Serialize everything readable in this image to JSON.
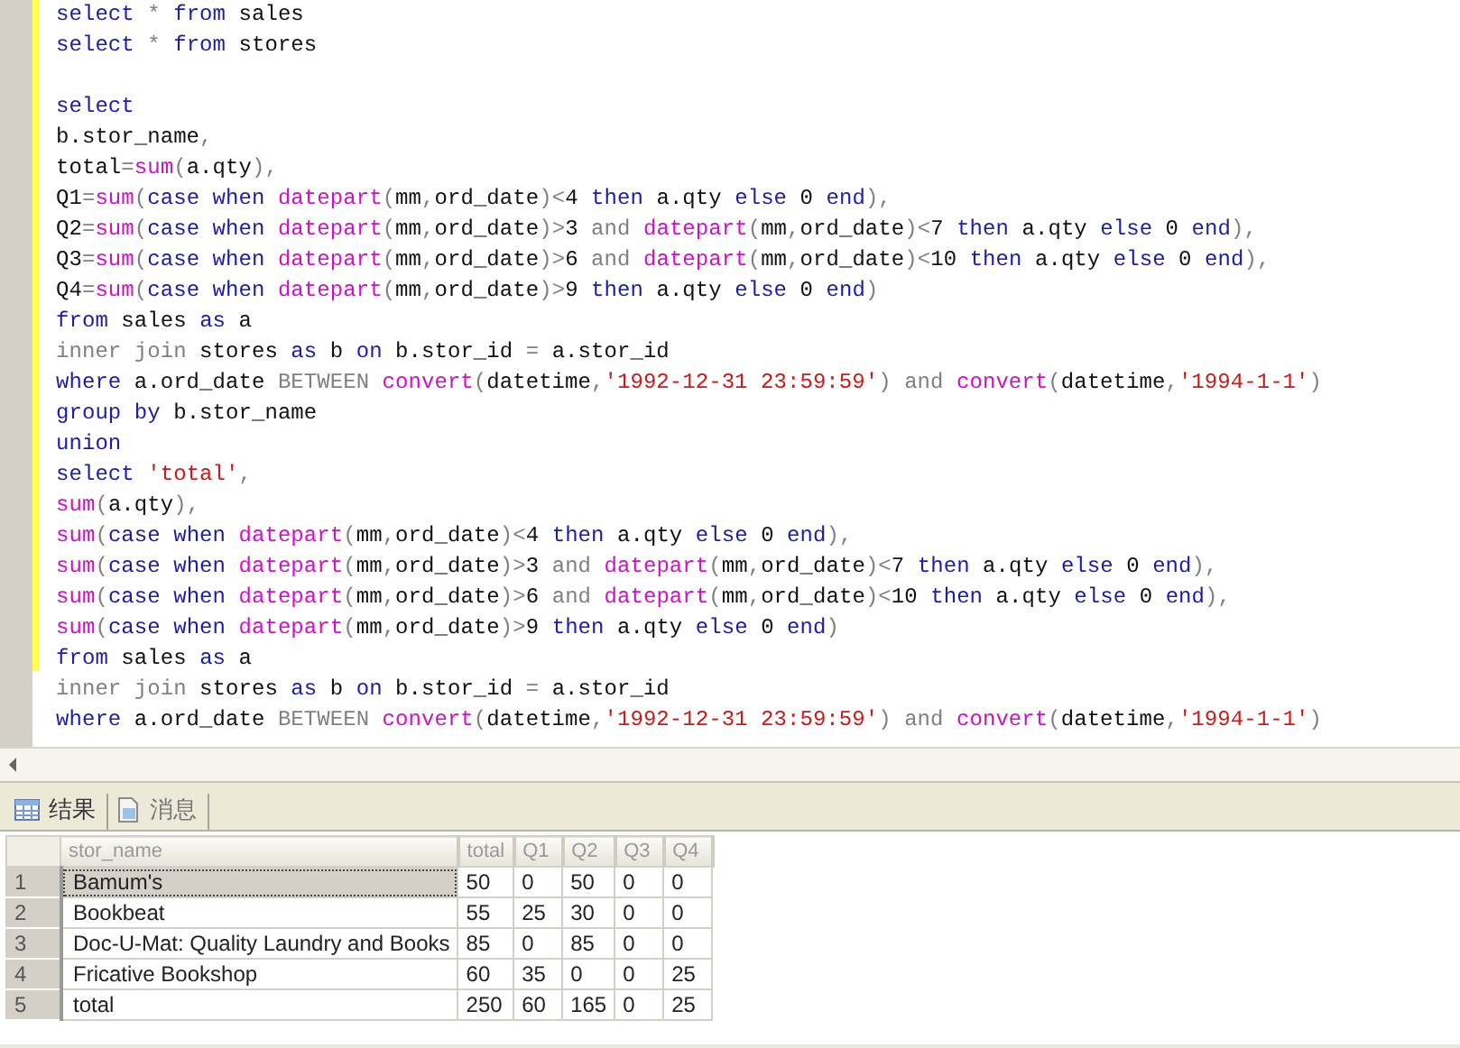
{
  "editor": {
    "blocks": [
      {
        "lines": [
          {
            "tokens": [
              {
                "kind": "keyword",
                "text": "select"
              },
              {
                "kind": "operator",
                "text": " * "
              },
              {
                "kind": "keyword",
                "text": "from"
              },
              {
                "kind": "plain",
                "text": " sales"
              }
            ]
          },
          {
            "tokens": [
              {
                "kind": "keyword",
                "text": "select"
              },
              {
                "kind": "operator",
                "text": " * "
              },
              {
                "kind": "keyword",
                "text": "from"
              },
              {
                "kind": "plain",
                "text": " stores"
              }
            ]
          }
        ]
      },
      {
        "lines": [
          {
            "tokens": [
              {
                "kind": "keyword",
                "text": "select"
              }
            ]
          },
          {
            "tokens": [
              {
                "kind": "plain",
                "text": "b.stor_name"
              },
              {
                "kind": "operator",
                "text": ","
              }
            ]
          },
          {
            "tokens": [
              {
                "kind": "plain",
                "text": "total"
              },
              {
                "kind": "operator",
                "text": "="
              },
              {
                "kind": "function",
                "text": "sum"
              },
              {
                "kind": "operator",
                "text": "("
              },
              {
                "kind": "plain",
                "text": "a.qty"
              },
              {
                "kind": "operator",
                "text": "),"
              }
            ]
          },
          {
            "tokens": [
              {
                "kind": "plain",
                "text": "Q1"
              },
              {
                "kind": "operator",
                "text": "="
              },
              {
                "kind": "function",
                "text": "sum"
              },
              {
                "kind": "operator",
                "text": "("
              },
              {
                "kind": "keyword",
                "text": "case when "
              },
              {
                "kind": "function",
                "text": "datepart"
              },
              {
                "kind": "operator",
                "text": "("
              },
              {
                "kind": "plain",
                "text": "mm"
              },
              {
                "kind": "operator",
                "text": ","
              },
              {
                "kind": "plain",
                "text": "ord_date"
              },
              {
                "kind": "operator",
                "text": ")<"
              },
              {
                "kind": "plain",
                "text": "4 "
              },
              {
                "kind": "keyword",
                "text": "then"
              },
              {
                "kind": "plain",
                "text": " a.qty "
              },
              {
                "kind": "keyword",
                "text": "else"
              },
              {
                "kind": "plain",
                "text": " 0 "
              },
              {
                "kind": "keyword",
                "text": "end"
              },
              {
                "kind": "operator",
                "text": "),"
              }
            ]
          },
          {
            "tokens": [
              {
                "kind": "plain",
                "text": "Q2"
              },
              {
                "kind": "operator",
                "text": "="
              },
              {
                "kind": "function",
                "text": "sum"
              },
              {
                "kind": "operator",
                "text": "("
              },
              {
                "kind": "keyword",
                "text": "case when "
              },
              {
                "kind": "function",
                "text": "datepart"
              },
              {
                "kind": "operator",
                "text": "("
              },
              {
                "kind": "plain",
                "text": "mm"
              },
              {
                "kind": "operator",
                "text": ","
              },
              {
                "kind": "plain",
                "text": "ord_date"
              },
              {
                "kind": "operator",
                "text": ")>"
              },
              {
                "kind": "plain",
                "text": "3 "
              },
              {
                "kind": "operator",
                "text": "and "
              },
              {
                "kind": "function",
                "text": "datepart"
              },
              {
                "kind": "operator",
                "text": "("
              },
              {
                "kind": "plain",
                "text": "mm"
              },
              {
                "kind": "operator",
                "text": ","
              },
              {
                "kind": "plain",
                "text": "ord_date"
              },
              {
                "kind": "operator",
                "text": ")<"
              },
              {
                "kind": "plain",
                "text": "7 "
              },
              {
                "kind": "keyword",
                "text": "then"
              },
              {
                "kind": "plain",
                "text": " a.qty "
              },
              {
                "kind": "keyword",
                "text": "else"
              },
              {
                "kind": "plain",
                "text": " 0 "
              },
              {
                "kind": "keyword",
                "text": "end"
              },
              {
                "kind": "operator",
                "text": "),"
              }
            ]
          },
          {
            "tokens": [
              {
                "kind": "plain",
                "text": "Q3"
              },
              {
                "kind": "operator",
                "text": "="
              },
              {
                "kind": "function",
                "text": "sum"
              },
              {
                "kind": "operator",
                "text": "("
              },
              {
                "kind": "keyword",
                "text": "case when "
              },
              {
                "kind": "function",
                "text": "datepart"
              },
              {
                "kind": "operator",
                "text": "("
              },
              {
                "kind": "plain",
                "text": "mm"
              },
              {
                "kind": "operator",
                "text": ","
              },
              {
                "kind": "plain",
                "text": "ord_date"
              },
              {
                "kind": "operator",
                "text": ")>"
              },
              {
                "kind": "plain",
                "text": "6 "
              },
              {
                "kind": "operator",
                "text": "and "
              },
              {
                "kind": "function",
                "text": "datepart"
              },
              {
                "kind": "operator",
                "text": "("
              },
              {
                "kind": "plain",
                "text": "mm"
              },
              {
                "kind": "operator",
                "text": ","
              },
              {
                "kind": "plain",
                "text": "ord_date"
              },
              {
                "kind": "operator",
                "text": ")<"
              },
              {
                "kind": "plain",
                "text": "10 "
              },
              {
                "kind": "keyword",
                "text": "then"
              },
              {
                "kind": "plain",
                "text": " a.qty "
              },
              {
                "kind": "keyword",
                "text": "else"
              },
              {
                "kind": "plain",
                "text": " 0 "
              },
              {
                "kind": "keyword",
                "text": "end"
              },
              {
                "kind": "operator",
                "text": "),"
              }
            ]
          },
          {
            "tokens": [
              {
                "kind": "plain",
                "text": "Q4"
              },
              {
                "kind": "operator",
                "text": "="
              },
              {
                "kind": "function",
                "text": "sum"
              },
              {
                "kind": "operator",
                "text": "("
              },
              {
                "kind": "keyword",
                "text": "case when "
              },
              {
                "kind": "function",
                "text": "datepart"
              },
              {
                "kind": "operator",
                "text": "("
              },
              {
                "kind": "plain",
                "text": "mm"
              },
              {
                "kind": "operator",
                "text": ","
              },
              {
                "kind": "plain",
                "text": "ord_date"
              },
              {
                "kind": "operator",
                "text": ")>"
              },
              {
                "kind": "plain",
                "text": "9 "
              },
              {
                "kind": "keyword",
                "text": "then"
              },
              {
                "kind": "plain",
                "text": " a.qty "
              },
              {
                "kind": "keyword",
                "text": "else"
              },
              {
                "kind": "plain",
                "text": " 0 "
              },
              {
                "kind": "keyword",
                "text": "end"
              },
              {
                "kind": "operator",
                "text": ")"
              }
            ]
          },
          {
            "tokens": [
              {
                "kind": "keyword",
                "text": "from"
              },
              {
                "kind": "plain",
                "text": " sales "
              },
              {
                "kind": "keyword",
                "text": "as"
              },
              {
                "kind": "plain",
                "text": " a"
              }
            ]
          },
          {
            "tokens": [
              {
                "kind": "operator",
                "text": "inner join"
              },
              {
                "kind": "plain",
                "text": " stores "
              },
              {
                "kind": "keyword",
                "text": "as"
              },
              {
                "kind": "plain",
                "text": " b "
              },
              {
                "kind": "keyword",
                "text": "on"
              },
              {
                "kind": "plain",
                "text": " b.stor_id "
              },
              {
                "kind": "operator",
                "text": "="
              },
              {
                "kind": "plain",
                "text": " a.stor_id"
              }
            ]
          },
          {
            "tokens": [
              {
                "kind": "keyword",
                "text": "where"
              },
              {
                "kind": "plain",
                "text": " a.ord_date "
              },
              {
                "kind": "operator",
                "text": "BETWEEN "
              },
              {
                "kind": "function",
                "text": "convert"
              },
              {
                "kind": "operator",
                "text": "("
              },
              {
                "kind": "plain",
                "text": "datetime"
              },
              {
                "kind": "operator",
                "text": ","
              },
              {
                "kind": "string",
                "text": "'1992-12-31 23:59:59'"
              },
              {
                "kind": "operator",
                "text": ") and "
              },
              {
                "kind": "function",
                "text": "convert"
              },
              {
                "kind": "operator",
                "text": "("
              },
              {
                "kind": "plain",
                "text": "datetime"
              },
              {
                "kind": "operator",
                "text": ","
              },
              {
                "kind": "string",
                "text": "'1994-1-1'"
              },
              {
                "kind": "operator",
                "text": ")"
              }
            ]
          },
          {
            "tokens": [
              {
                "kind": "keyword",
                "text": "group by"
              },
              {
                "kind": "plain",
                "text": " b.stor_name"
              }
            ]
          },
          {
            "tokens": [
              {
                "kind": "keyword",
                "text": "union"
              }
            ]
          },
          {
            "tokens": [
              {
                "kind": "keyword",
                "text": "select "
              },
              {
                "kind": "string",
                "text": "'total'"
              },
              {
                "kind": "operator",
                "text": ","
              }
            ]
          },
          {
            "tokens": [
              {
                "kind": "function",
                "text": "sum"
              },
              {
                "kind": "operator",
                "text": "("
              },
              {
                "kind": "plain",
                "text": "a.qty"
              },
              {
                "kind": "operator",
                "text": "),"
              }
            ]
          },
          {
            "tokens": [
              {
                "kind": "function",
                "text": "sum"
              },
              {
                "kind": "operator",
                "text": "("
              },
              {
                "kind": "keyword",
                "text": "case when "
              },
              {
                "kind": "function",
                "text": "datepart"
              },
              {
                "kind": "operator",
                "text": "("
              },
              {
                "kind": "plain",
                "text": "mm"
              },
              {
                "kind": "operator",
                "text": ","
              },
              {
                "kind": "plain",
                "text": "ord_date"
              },
              {
                "kind": "operator",
                "text": ")<"
              },
              {
                "kind": "plain",
                "text": "4 "
              },
              {
                "kind": "keyword",
                "text": "then"
              },
              {
                "kind": "plain",
                "text": " a.qty "
              },
              {
                "kind": "keyword",
                "text": "else"
              },
              {
                "kind": "plain",
                "text": " 0 "
              },
              {
                "kind": "keyword",
                "text": "end"
              },
              {
                "kind": "operator",
                "text": "),"
              }
            ]
          },
          {
            "tokens": [
              {
                "kind": "function",
                "text": "sum"
              },
              {
                "kind": "operator",
                "text": "("
              },
              {
                "kind": "keyword",
                "text": "case when "
              },
              {
                "kind": "function",
                "text": "datepart"
              },
              {
                "kind": "operator",
                "text": "("
              },
              {
                "kind": "plain",
                "text": "mm"
              },
              {
                "kind": "operator",
                "text": ","
              },
              {
                "kind": "plain",
                "text": "ord_date"
              },
              {
                "kind": "operator",
                "text": ")>"
              },
              {
                "kind": "plain",
                "text": "3 "
              },
              {
                "kind": "operator",
                "text": "and "
              },
              {
                "kind": "function",
                "text": "datepart"
              },
              {
                "kind": "operator",
                "text": "("
              },
              {
                "kind": "plain",
                "text": "mm"
              },
              {
                "kind": "operator",
                "text": ","
              },
              {
                "kind": "plain",
                "text": "ord_date"
              },
              {
                "kind": "operator",
                "text": ")<"
              },
              {
                "kind": "plain",
                "text": "7 "
              },
              {
                "kind": "keyword",
                "text": "then"
              },
              {
                "kind": "plain",
                "text": " a.qty "
              },
              {
                "kind": "keyword",
                "text": "else"
              },
              {
                "kind": "plain",
                "text": " 0 "
              },
              {
                "kind": "keyword",
                "text": "end"
              },
              {
                "kind": "operator",
                "text": "),"
              }
            ]
          },
          {
            "tokens": [
              {
                "kind": "function",
                "text": "sum"
              },
              {
                "kind": "operator",
                "text": "("
              },
              {
                "kind": "keyword",
                "text": "case when "
              },
              {
                "kind": "function",
                "text": "datepart"
              },
              {
                "kind": "operator",
                "text": "("
              },
              {
                "kind": "plain",
                "text": "mm"
              },
              {
                "kind": "operator",
                "text": ","
              },
              {
                "kind": "plain",
                "text": "ord_date"
              },
              {
                "kind": "operator",
                "text": ")>"
              },
              {
                "kind": "plain",
                "text": "6 "
              },
              {
                "kind": "operator",
                "text": "and "
              },
              {
                "kind": "function",
                "text": "datepart"
              },
              {
                "kind": "operator",
                "text": "("
              },
              {
                "kind": "plain",
                "text": "mm"
              },
              {
                "kind": "operator",
                "text": ","
              },
              {
                "kind": "plain",
                "text": "ord_date"
              },
              {
                "kind": "operator",
                "text": ")<"
              },
              {
                "kind": "plain",
                "text": "10 "
              },
              {
                "kind": "keyword",
                "text": "then"
              },
              {
                "kind": "plain",
                "text": " a.qty "
              },
              {
                "kind": "keyword",
                "text": "else"
              },
              {
                "kind": "plain",
                "text": " 0 "
              },
              {
                "kind": "keyword",
                "text": "end"
              },
              {
                "kind": "operator",
                "text": "),"
              }
            ]
          },
          {
            "tokens": [
              {
                "kind": "function",
                "text": "sum"
              },
              {
                "kind": "operator",
                "text": "("
              },
              {
                "kind": "keyword",
                "text": "case when "
              },
              {
                "kind": "function",
                "text": "datepart"
              },
              {
                "kind": "operator",
                "text": "("
              },
              {
                "kind": "plain",
                "text": "mm"
              },
              {
                "kind": "operator",
                "text": ","
              },
              {
                "kind": "plain",
                "text": "ord_date"
              },
              {
                "kind": "operator",
                "text": ")>"
              },
              {
                "kind": "plain",
                "text": "9 "
              },
              {
                "kind": "keyword",
                "text": "then"
              },
              {
                "kind": "plain",
                "text": " a.qty "
              },
              {
                "kind": "keyword",
                "text": "else"
              },
              {
                "kind": "plain",
                "text": " 0 "
              },
              {
                "kind": "keyword",
                "text": "end"
              },
              {
                "kind": "operator",
                "text": ")"
              }
            ]
          },
          {
            "tokens": [
              {
                "kind": "keyword",
                "text": "from"
              },
              {
                "kind": "plain",
                "text": " sales "
              },
              {
                "kind": "keyword",
                "text": "as"
              },
              {
                "kind": "plain",
                "text": " a"
              }
            ]
          },
          {
            "tokens": [
              {
                "kind": "operator",
                "text": "inner join"
              },
              {
                "kind": "plain",
                "text": " stores "
              },
              {
                "kind": "keyword",
                "text": "as"
              },
              {
                "kind": "plain",
                "text": " b "
              },
              {
                "kind": "keyword",
                "text": "on"
              },
              {
                "kind": "plain",
                "text": " b.stor_id "
              },
              {
                "kind": "operator",
                "text": "="
              },
              {
                "kind": "plain",
                "text": " a.stor_id"
              }
            ]
          },
          {
            "tokens": [
              {
                "kind": "keyword",
                "text": "where"
              },
              {
                "kind": "plain",
                "text": " a.ord_date "
              },
              {
                "kind": "operator",
                "text": "BETWEEN "
              },
              {
                "kind": "function",
                "text": "convert"
              },
              {
                "kind": "operator",
                "text": "("
              },
              {
                "kind": "plain",
                "text": "datetime"
              },
              {
                "kind": "operator",
                "text": ","
              },
              {
                "kind": "string",
                "text": "'1992-12-31 23:59:59'"
              },
              {
                "kind": "operator",
                "text": ") and "
              },
              {
                "kind": "function",
                "text": "convert"
              },
              {
                "kind": "operator",
                "text": "("
              },
              {
                "kind": "plain",
                "text": "datetime"
              },
              {
                "kind": "operator",
                "text": ","
              },
              {
                "kind": "string",
                "text": "'1994-1-1'"
              },
              {
                "kind": "operator",
                "text": ")"
              }
            ]
          }
        ]
      }
    ]
  },
  "result_tabs": [
    {
      "label": "结果",
      "kind": "grid",
      "selected": true
    },
    {
      "label": "消息",
      "kind": "messages",
      "selected": false
    }
  ],
  "table": {
    "columns": [
      "stor_name",
      "total",
      "Q1",
      "Q2",
      "Q3",
      "Q4"
    ],
    "rows": [
      {
        "number": "1",
        "selected": true,
        "cells": [
          "Bamum's",
          "50",
          "0",
          "50",
          "0",
          "0"
        ]
      },
      {
        "number": "2",
        "selected": false,
        "cells": [
          "Bookbeat",
          "55",
          "25",
          "30",
          "0",
          "0"
        ]
      },
      {
        "number": "3",
        "selected": false,
        "cells": [
          "Doc-U-Mat: Quality Laundry and Books",
          "85",
          "0",
          "85",
          "0",
          "0"
        ]
      },
      {
        "number": "4",
        "selected": false,
        "cells": [
          "Fricative Bookshop",
          "60",
          "35",
          "0",
          "0",
          "25"
        ]
      },
      {
        "number": "5",
        "selected": false,
        "cells": [
          "total",
          "250",
          "60",
          "165",
          "0",
          "25"
        ]
      }
    ]
  }
}
